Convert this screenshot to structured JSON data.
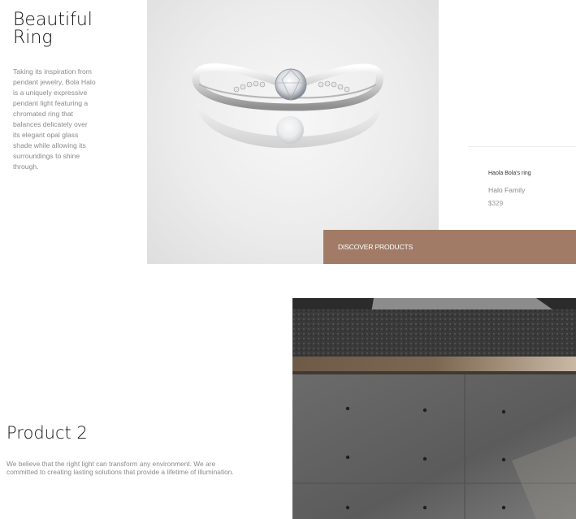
{
  "hero": {
    "title": "Beautiful Ring",
    "description": "Taking its inspiration from pendant jewelry, Bola Halo is a uniquely expressive pendant light featuring a chromated ring that balances delicately over its elegant opal glass shade while allowing its surroundings to shine through.",
    "image_alt": "Diamond ring"
  },
  "product_card": {
    "name": "Haola Bola's ring",
    "family": "Halo Family",
    "price": "$329"
  },
  "discover_button": {
    "label": "DISCOVER PRODUCTS",
    "color": "#a17b66"
  },
  "product2": {
    "title": "Product 2",
    "description": "We believe that the right light can transform any environment. We are committed to creating lasting solutions that provide a lifetime of illumination.",
    "image_alt": "Concrete wall with rug"
  }
}
